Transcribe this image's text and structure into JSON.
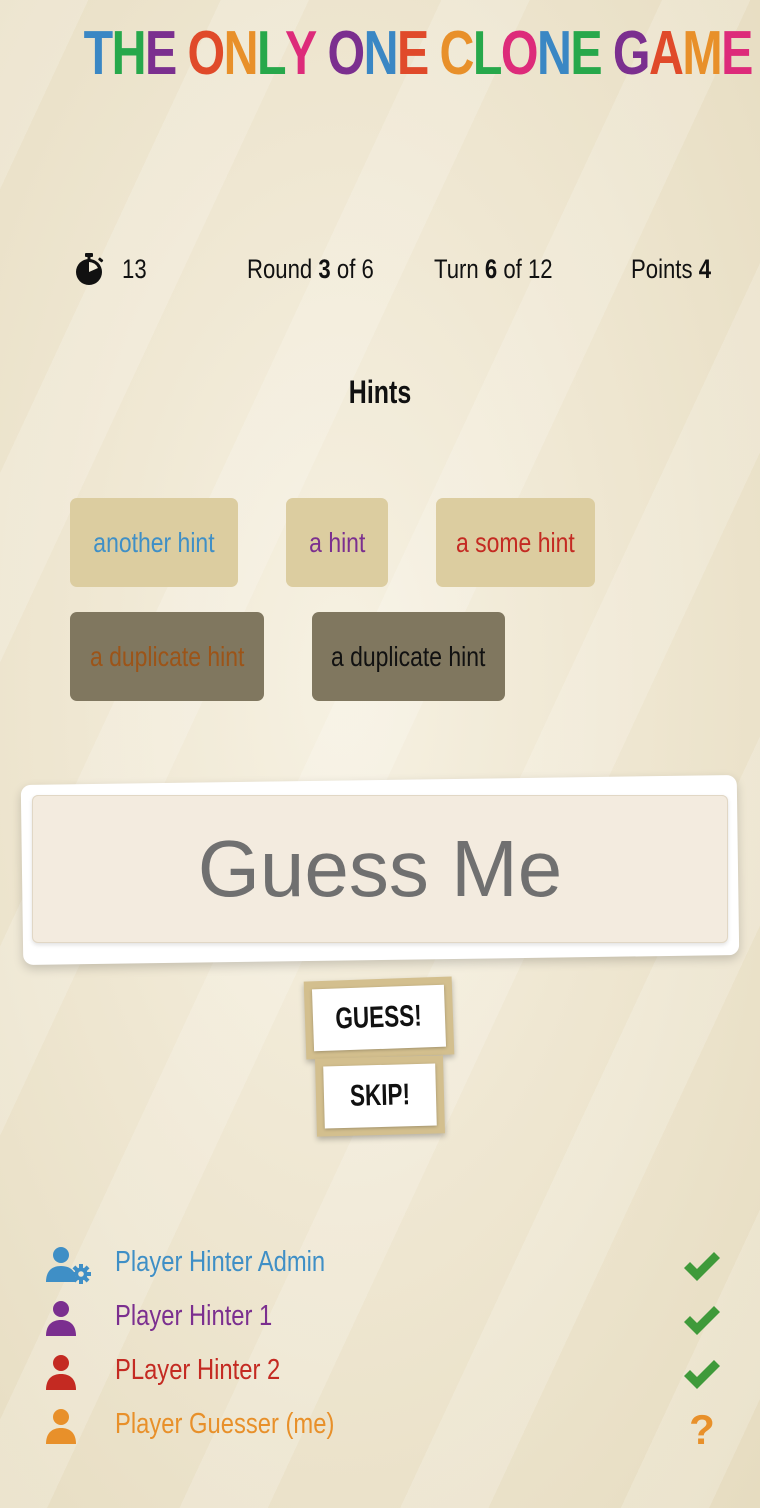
{
  "title": {
    "text": "THE ONLY ONE CLONE GAME",
    "letter_colors": [
      "#3a87c4",
      "#27a84b",
      "#7b2f8f",
      "#e04a2a",
      "#e8902a",
      "#27a84b",
      "#dd2b7a",
      "#7b2f8f",
      "#3a87c4",
      "#e04a2a",
      "#e8902a",
      "#27a84b",
      "#dd2b7a",
      "#3a87c4",
      "#27a84b",
      "#7b2f8f",
      "#e04a2a",
      "#e8902a",
      "#dd2b7a",
      "#27a84b",
      "#7b2f8f",
      "#3a87c4",
      "#27a84b"
    ]
  },
  "stats": {
    "timer_icon": "stopwatch-icon",
    "timer_value": "13",
    "round_label": "Round",
    "round_current": "3",
    "round_of": "of",
    "round_total": "6",
    "turn_label": "Turn",
    "turn_current": "6",
    "turn_of": "of",
    "turn_total": "12",
    "points_label": "Points",
    "points_value": "4"
  },
  "hints": {
    "heading": "Hints",
    "items": [
      {
        "text": "another hint",
        "color": "#3f8fc6",
        "duplicate": false
      },
      {
        "text": "a hint",
        "color": "#7b2f8f",
        "duplicate": false
      },
      {
        "text": "a some hint",
        "color": "#c42a22",
        "duplicate": false
      },
      {
        "text": "a duplicate hint",
        "color": "#9c5418",
        "duplicate": true
      },
      {
        "text": "a duplicate hint",
        "color": "#111111",
        "duplicate": true
      }
    ]
  },
  "guess": {
    "placeholder": "Guess Me",
    "value": ""
  },
  "buttons": {
    "guess_label": "GUESS!",
    "skip_label": "SKIP!"
  },
  "players": [
    {
      "name": "Player Hinter Admin",
      "color": "#3f8fc6",
      "icon": "user-cog-icon",
      "status": "check-icon"
    },
    {
      "name": "Player Hinter 1",
      "color": "#7b2f8f",
      "icon": "user-icon",
      "status": "check-icon"
    },
    {
      "name": "PLayer Hinter 2",
      "color": "#c42a22",
      "icon": "user-icon",
      "status": "check-icon"
    },
    {
      "name": "Player Guesser (me)",
      "color": "#e8902a",
      "icon": "user-icon",
      "status": "question-icon"
    }
  ],
  "colors": {
    "check": "#3f9a3a",
    "question": "#e8902a",
    "hint_bg": "#dccda0",
    "hint_duplicate_bg": "#80775f"
  }
}
